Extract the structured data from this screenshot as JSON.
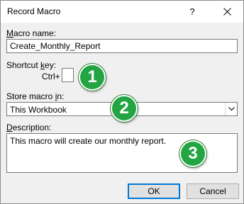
{
  "window": {
    "title": "Record Macro",
    "help_label": "?",
    "close_icon": "close-icon"
  },
  "macro_name": {
    "label_accel": "M",
    "label_rest": "acro name:",
    "value": "Create_Monthly_Report"
  },
  "shortcut_key": {
    "label_pre": "Shortcut ",
    "label_accel": "k",
    "label_post": "ey:",
    "prefix": "Ctrl+",
    "value": ""
  },
  "store_macro": {
    "label_pre": "Store macro ",
    "label_accel": "i",
    "label_post": "n:",
    "selected": "This Workbook",
    "arrow_icon": "chevron-down-icon"
  },
  "description": {
    "label_accel": "D",
    "label_rest": "escription:",
    "value": "This macro will create our monthly report."
  },
  "buttons": {
    "ok": "OK",
    "cancel": "Cancel"
  },
  "annotations": [
    "1",
    "2",
    "3"
  ],
  "colors": {
    "badge_green": "#23a543",
    "focus_blue": "#0078d7"
  }
}
